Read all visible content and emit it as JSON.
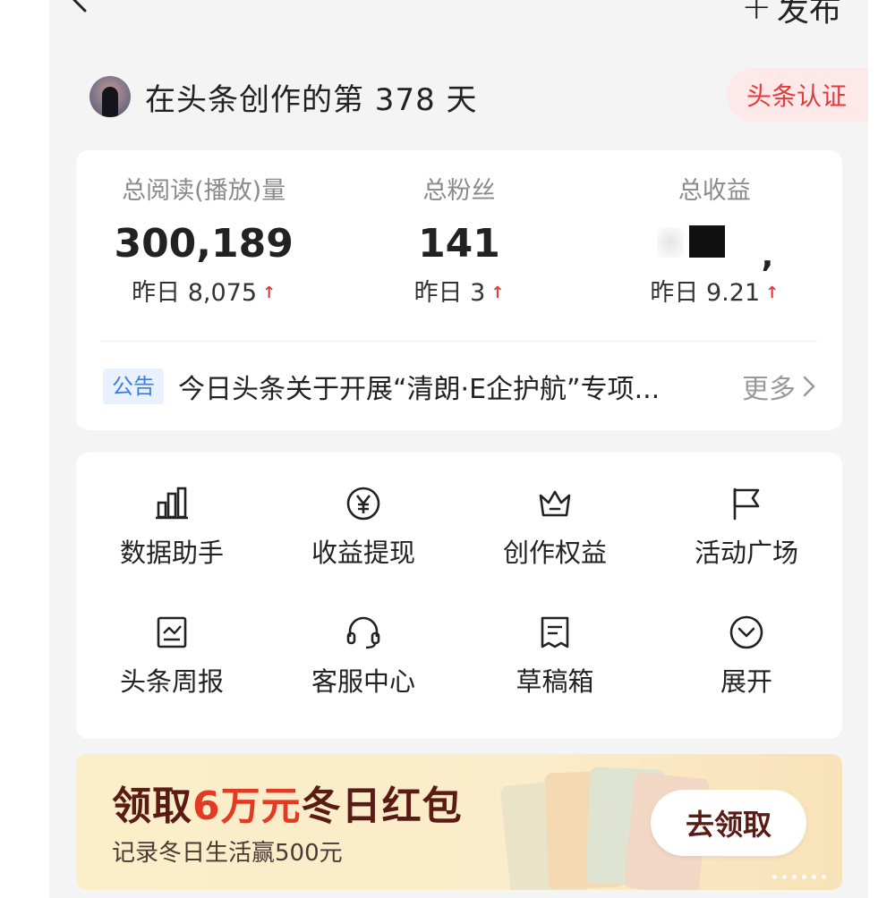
{
  "topbar": {
    "publish_plus": "+",
    "publish_label": "发布"
  },
  "creator": {
    "days_text": "在头条创作的第 378 天",
    "verify_label": "头条认证"
  },
  "stats": [
    {
      "label": "总阅读(播放)量",
      "value": "300,189",
      "delta": "昨日 8,075"
    },
    {
      "label": "总粉丝",
      "value": "141",
      "delta": "昨日 3"
    },
    {
      "label": "总收益",
      "value": "",
      "delta": "昨日 9.21"
    }
  ],
  "notice": {
    "tag": "公告",
    "text": "今日头条关于开展“清朗·E企护航”专项...",
    "more": "更多"
  },
  "tools": [
    {
      "label": "数据助手",
      "icon": "bar-chart-icon"
    },
    {
      "label": "收益提现",
      "icon": "yuan-icon"
    },
    {
      "label": "创作权益",
      "icon": "crown-icon"
    },
    {
      "label": "活动广场",
      "icon": "flag-icon"
    },
    {
      "label": "头条周报",
      "icon": "report-icon"
    },
    {
      "label": "客服中心",
      "icon": "headset-icon"
    },
    {
      "label": "草稿箱",
      "icon": "draft-icon"
    },
    {
      "label": "展开",
      "icon": "chevron-down-circle-icon"
    }
  ],
  "banner": {
    "title_pre": "领取",
    "title_highlight": "6万元",
    "title_post": "冬日红包",
    "subtitle": "记录冬日生活赢500元",
    "cta": "去领取"
  },
  "colors": {
    "accent_red": "#e33b3b",
    "notice_blue": "#3b7ee0",
    "banner_brown": "#5a1b14"
  }
}
